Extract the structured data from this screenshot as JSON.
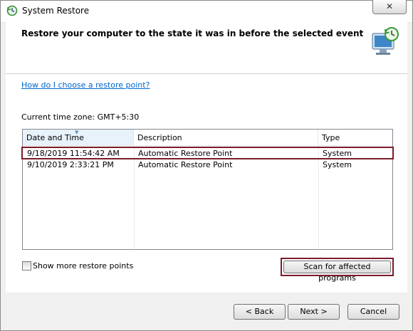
{
  "window": {
    "title": "System Restore",
    "close_label": "✕"
  },
  "header": {
    "text": "Restore your computer to the state it was in before the selected event"
  },
  "help_link": "How do I choose a restore point?",
  "timezone": "Current time zone: GMT+5:30",
  "table": {
    "columns": [
      "Date and Time",
      "Description",
      "Type"
    ],
    "rows": [
      {
        "date": "9/18/2019 11:54:42 AM",
        "description": "Automatic Restore Point",
        "type": "System",
        "selected": true
      },
      {
        "date": "9/10/2019 2:33:21 PM",
        "description": "Automatic Restore Point",
        "type": "System",
        "selected": false
      }
    ]
  },
  "show_more": {
    "label": "Show more restore points",
    "checked": false
  },
  "scan_button": "Scan for affected programs",
  "buttons": {
    "back": "< Back",
    "next": "Next >",
    "cancel": "Cancel"
  },
  "colors": {
    "highlight_border": "#7b1b2b",
    "link": "#0066cc"
  }
}
